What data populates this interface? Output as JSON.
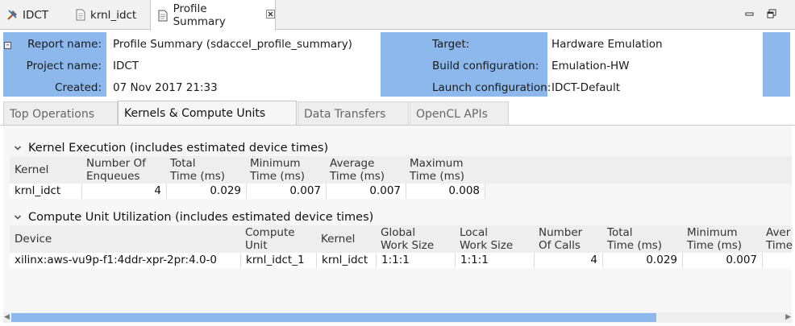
{
  "editor_tabs": [
    {
      "label": "IDCT",
      "icon": "tools-icon"
    },
    {
      "label": "krnl_idct",
      "icon": "document-icon"
    },
    {
      "label": "Profile Summary",
      "icon": "document-icon",
      "active": true
    }
  ],
  "report_header": {
    "report_name_label": "Report name:",
    "report_name": "Profile Summary (sdaccel_profile_summary)",
    "project_name_label": "Project name:",
    "project_name": "IDCT",
    "created_label": "Created:",
    "created": "07 Nov 2017 21:33",
    "target_label": "Target:",
    "target": "Hardware Emulation",
    "build_config_label": "Build configuration:",
    "build_config": "Emulation-HW",
    "launch_config_label": "Launch configuration:",
    "launch_config": "IDCT-Default",
    "accent_color": "#8cb8ec"
  },
  "section_tabs": [
    {
      "label": "Top Operations"
    },
    {
      "label": "Kernels & Compute Units",
      "active": true
    },
    {
      "label": "Data Transfers"
    },
    {
      "label": "OpenCL APIs"
    }
  ],
  "kernel_execution": {
    "title": "Kernel Execution (includes estimated device times)",
    "columns": [
      "Kernel",
      "Number Of\nEnqueues",
      "Total\nTime (ms)",
      "Minimum\nTime (ms)",
      "Average\nTime (ms)",
      "Maximum\nTime (ms)"
    ],
    "rows": [
      [
        "krnl_idct",
        "4",
        "0.029",
        "0.007",
        "0.007",
        "0.008"
      ]
    ]
  },
  "compute_unit_utilization": {
    "title": "Compute Unit Utilization (includes estimated device times)",
    "columns": [
      "Device",
      "Compute\nUnit",
      "Kernel",
      "Global\nWork Size",
      "Local\nWork Size",
      "Number\nOf Calls",
      "Total\nTime (ms)",
      "Minimum\nTime (ms)",
      "Aver\nTime"
    ],
    "rows": [
      [
        "xilinx:aws-vu9p-f1:4ddr-xpr-2pr:4.0-0",
        "krnl_idct_1",
        "krnl_idct",
        "1:1:1",
        "1:1:1",
        "4",
        "0.029",
        "0.007",
        ""
      ]
    ]
  }
}
